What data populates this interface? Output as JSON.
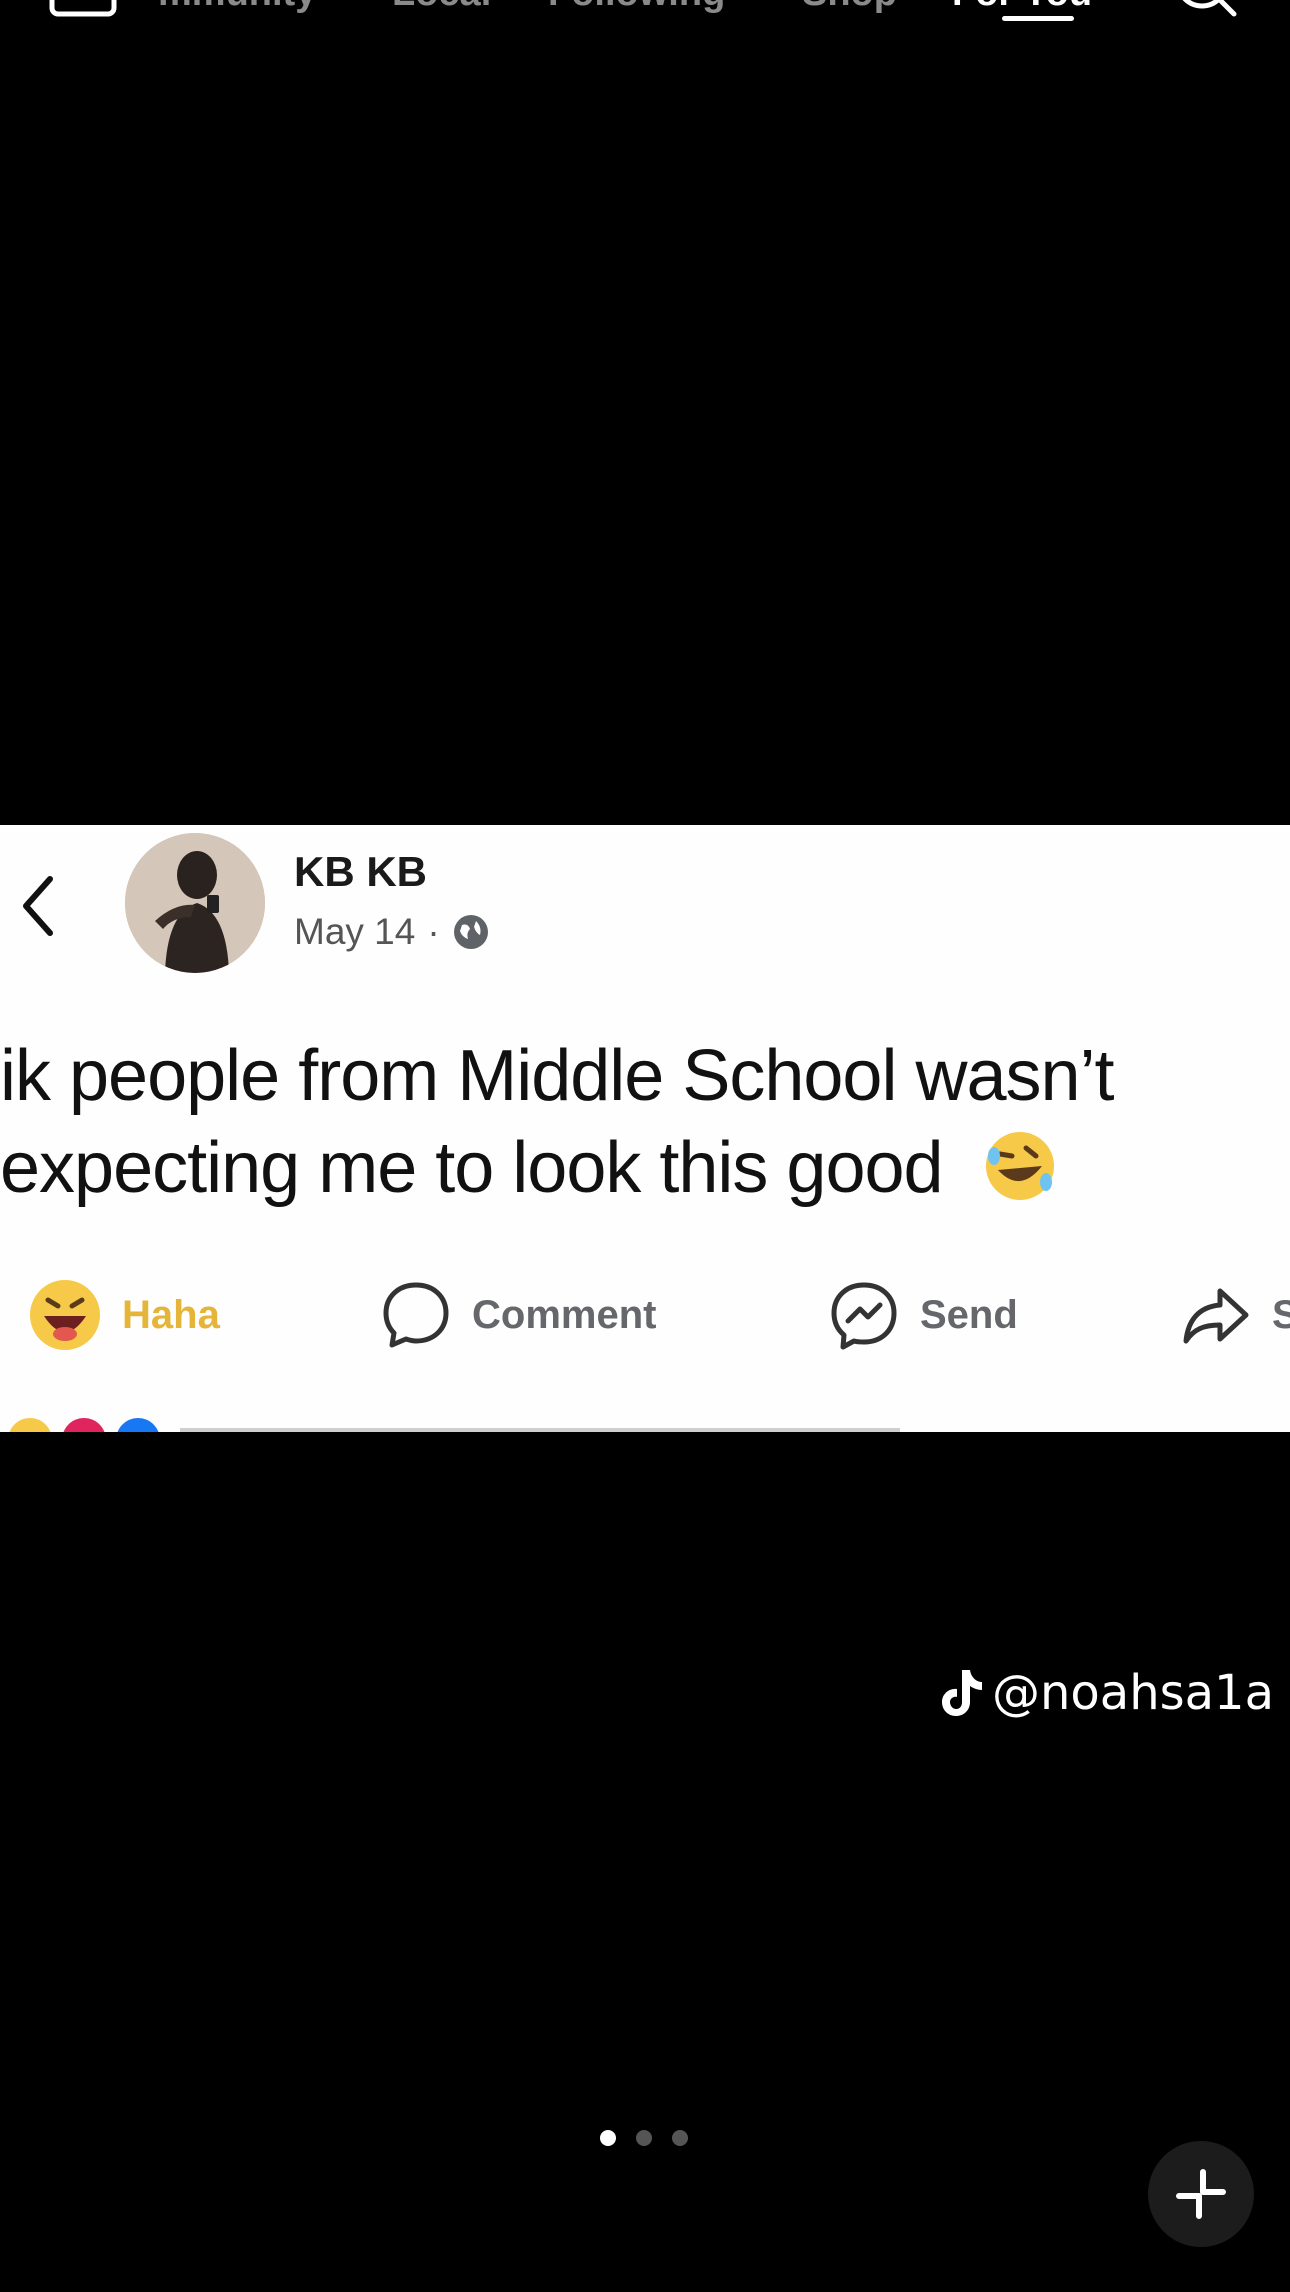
{
  "nav": {
    "tabs": [
      {
        "label": "mmunity",
        "active": false
      },
      {
        "label": "Local",
        "active": false
      },
      {
        "label": "Following",
        "active": false
      },
      {
        "label": "Shop",
        "active": false
      },
      {
        "label": "For You",
        "active": true
      }
    ]
  },
  "post": {
    "author": "KB KB",
    "date": "May 14",
    "separator": "·",
    "text_line1": "ik people from Middle School wasn’t",
    "text_line2": "expecting me to look this good",
    "actions": {
      "haha": "Haha",
      "comment": "Comment",
      "send": "Send",
      "share": "S"
    }
  },
  "watermark": "@noahsa1a",
  "pager": {
    "count": 3,
    "active_index": 0
  },
  "colors": {
    "background": "#000000",
    "haha_accent": "#e5b53a",
    "action_gray": "#65676b"
  }
}
